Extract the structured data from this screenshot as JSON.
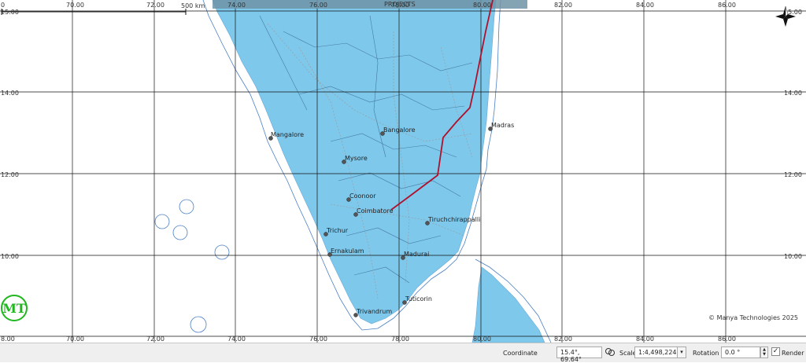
{
  "map": {
    "top_labels": [
      "0",
      "70.00",
      "72.00",
      "74.00",
      "76.00",
      "78.00",
      "80.00",
      "82.00",
      "84.00",
      "86.00"
    ],
    "bottom_labels": [
      "8.00",
      "70.00",
      "72.00",
      "74.00",
      "76.00",
      "78.00",
      "80.00",
      "82.00",
      "84.00",
      "86.00"
    ],
    "left_labels": [
      "15.00",
      "14.00",
      "12.00",
      "10.00"
    ],
    "right_labels": [
      "15.00",
      "14.00",
      "12.00",
      "10.00"
    ],
    "scale_bar_label": "500 km",
    "title_fragment": "PROJECTS",
    "cities": [
      "Bangalore",
      "Mangalore",
      "Mysore",
      "Madras",
      "Coonoor",
      "Coimbatore",
      "Tiruchchirappalli",
      "Trichur",
      "Ernakulam",
      "Madurai",
      "Tuticorin",
      "Trivandrum"
    ],
    "logo_text": "MT",
    "copyright": "© Manya Technologies 2025",
    "colors": {
      "land": "#7ec8ec",
      "water": "#ffffff",
      "route": "#b0102a",
      "logo": "#1fb81f"
    }
  },
  "statusbar": {
    "coordinate_label": "Coordinate",
    "coordinate_value": "15.4°, 69.64°",
    "scale_label": "Scale",
    "scale_value": "1:4,498,224",
    "rotation_label": "Rotation",
    "rotation_value": "0.0 °",
    "render_label": "Render",
    "render_checked": "✓"
  }
}
